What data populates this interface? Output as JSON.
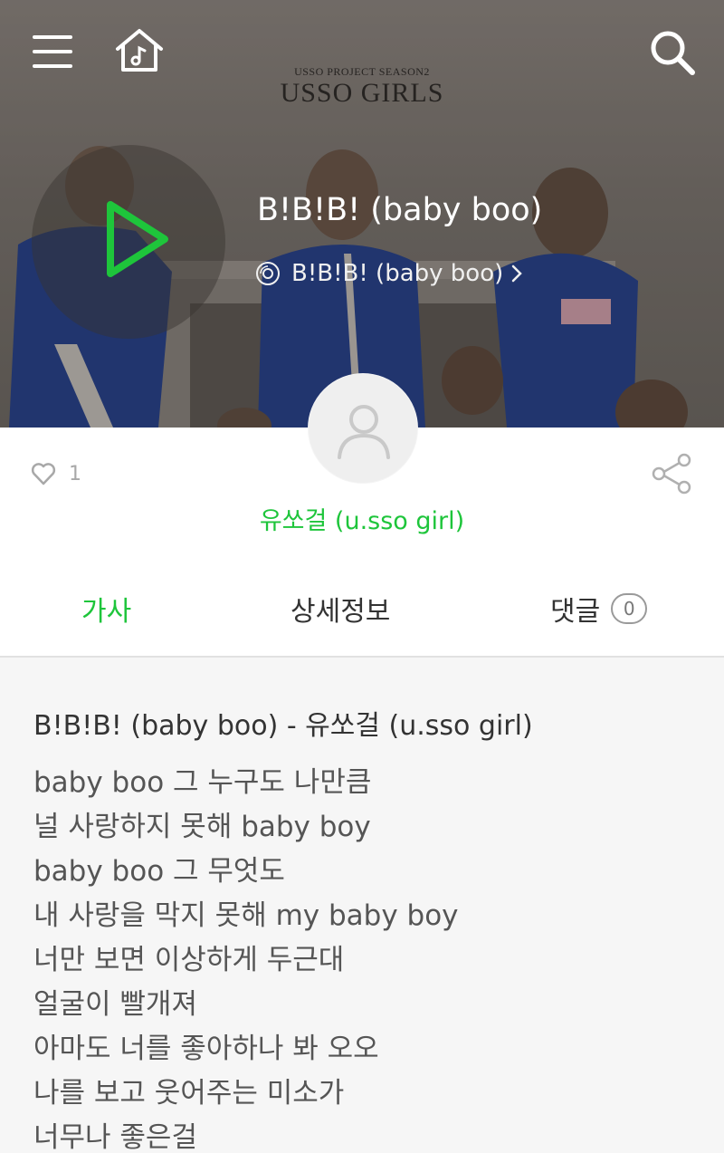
{
  "header": {
    "brand_sub": "USSO PROJECT SEASON2",
    "brand_main": "USSO GIRLS"
  },
  "song": {
    "title": "B!B!B! (baby boo)",
    "album": "B!B!B! (baby boo)",
    "artist": "유쏘걸 (u.sso girl)",
    "likes": "1"
  },
  "tabs": [
    {
      "label": "가사",
      "active": true
    },
    {
      "label": "상세정보",
      "active": false
    },
    {
      "label": "댓글",
      "active": false,
      "count": "0"
    }
  ],
  "lyrics": {
    "heading": "B!B!B! (baby boo) - 유쏘걸 (u.sso girl)",
    "lines": [
      "baby boo 그 누구도 나만큼",
      "널 사랑하지 못해 baby boy",
      "baby boo 그 무엇도",
      "내 사랑을 막지 못해 my baby boy",
      "너만 보면 이상하게 두근대",
      "얼굴이 빨개져",
      "아마도 너를 좋아하나 봐 오오",
      "나를 보고 웃어주는 미소가",
      "너무나 좋은걸"
    ]
  },
  "icons": {
    "menu": "hamburger-menu-icon",
    "home": "music-home-icon",
    "search": "search-icon",
    "play": "play-icon",
    "album": "disc-icon",
    "like": "heart-icon",
    "share": "share-icon",
    "avatar": "person-icon"
  },
  "colors": {
    "accent": "#1ec53b",
    "lyrics_background": "#f6f6f6"
  }
}
